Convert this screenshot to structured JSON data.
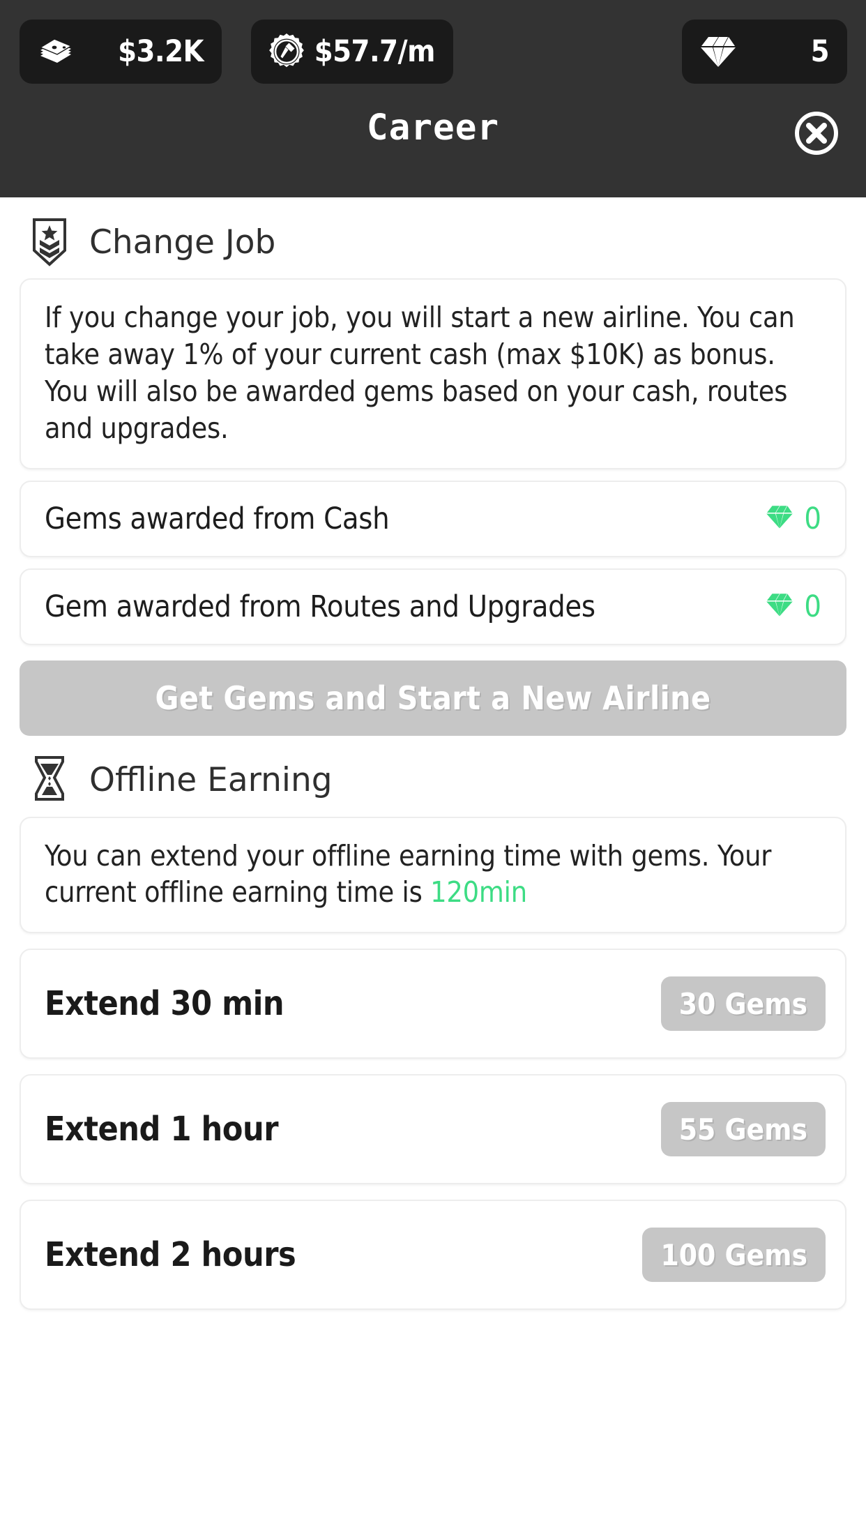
{
  "header": {
    "title": "Career",
    "close_icon": "close-circle-icon",
    "resources": [
      {
        "id": "cash",
        "icon": "money-stack-icon",
        "value": "$3.2K"
      },
      {
        "id": "income",
        "icon": "gear-hammer-icon",
        "value": "$57.7/m"
      },
      {
        "id": "gems",
        "icon": "diamond-icon",
        "value": "5"
      }
    ]
  },
  "sections": [
    {
      "id": "change-job",
      "icon": "rank-badge-icon",
      "title": "Change Job",
      "description": "If you change your job, you will start a new airline. You can take away 1% of your current cash (max $10K) as bonus. You will also be awarded gems based on your cash, routes and upgrades.",
      "rows": [
        {
          "label": "Gems awarded from Cash",
          "icon": "gem-icon",
          "value": "0"
        },
        {
          "label": "Gem awarded from Routes and Upgrades",
          "icon": "gem-icon",
          "value": "0"
        }
      ],
      "cta": {
        "label": "Get Gems and Start a New Airline",
        "enabled": false
      }
    },
    {
      "id": "offline-earning",
      "icon": "hourglass-icon",
      "title": "Offline Earning",
      "description_prefix": "You can extend your offline earning time with gems. Your current offline earning time is ",
      "current_time": "120min",
      "options": [
        {
          "label": "Extend 30 min",
          "price": "30 Gems",
          "enabled": false
        },
        {
          "label": "Extend 1 hour",
          "price": "55 Gems",
          "enabled": false
        },
        {
          "label": "Extend 2 hours",
          "price": "100 Gems",
          "enabled": false
        }
      ]
    }
  ],
  "colors": {
    "header_bg": "#333333",
    "pill_bg": "#1a1a1a",
    "accent_green": "#3ddc84",
    "disabled_gray": "#c6c6c6",
    "card_border": "#ededed"
  }
}
